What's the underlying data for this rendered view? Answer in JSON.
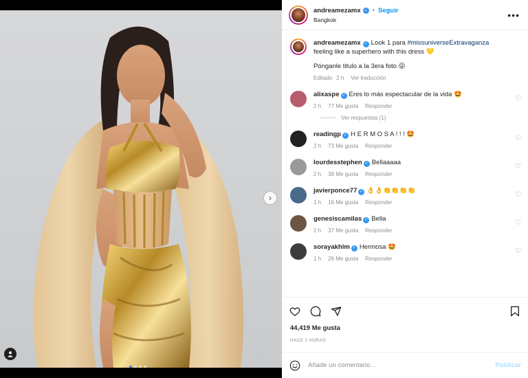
{
  "post": {
    "username": "andreamezamx",
    "follow_label": "Seguir",
    "separator": "•",
    "location": "Bangkok",
    "more_label": "•••",
    "next_label": "›"
  },
  "caption": {
    "username": "andreamezamx",
    "text_before": "Look 1 para ",
    "hashtag": "#missuniverseExtravaganza",
    "text_after": " feeling like a superhero with this dress 💛",
    "line2": "Pónganle titulo a la 3era foto 😜",
    "edited": "Editado",
    "time": "2 h",
    "translation": "Ver traducción"
  },
  "comments": [
    {
      "username": "alixaspe",
      "text": "Eres lo más espectacular de la vida 🤩",
      "time": "2 h",
      "likes": "77 Me gusta",
      "reply": "Responder",
      "avatar_color": "#b85c6e"
    },
    {
      "username": "readingp",
      "text": "H E R M O S A ! ! ! 🤩",
      "time": "2 h",
      "likes": "73 Me gusta",
      "reply": "Responder",
      "avatar_color": "#222222"
    },
    {
      "username": "lourdesstephen",
      "text": "Bellaaaaa",
      "time": "2 h",
      "likes": "38 Me gusta",
      "reply": "Responder",
      "avatar_color": "#9a9a9a"
    },
    {
      "username": "javierponce77",
      "text": "👌👌👏👏👏👏",
      "time": "1 h",
      "likes": "16 Me gusta",
      "reply": "Responder",
      "avatar_color": "#4a6a8a"
    },
    {
      "username": "genesiscamilas",
      "text": "Bella",
      "time": "2 h",
      "likes": "37 Me gusta",
      "reply": "Responder",
      "avatar_color": "#6b5544"
    },
    {
      "username": "sorayakhlm",
      "text": "Hermosa 🤩",
      "time": "1 h",
      "likes": "26 Me gusta",
      "reply": "Responder",
      "avatar_color": "#3d3d3d"
    }
  ],
  "replies_label": "Ver respuestas (1)",
  "likes_total": "44,419 Me gusta",
  "posted_ago": "HACE 2 HORAS",
  "composer": {
    "placeholder": "Añade un comentario...",
    "post_label": "Publicar"
  },
  "carousel": {
    "count": 4,
    "active": 0
  },
  "colors": {
    "accent": "#0095f6",
    "verified": "#3897f0",
    "hashtag": "#00376b",
    "dress_gold": "#c9a03c"
  },
  "icons": [
    "heart-icon",
    "comment-icon",
    "share-icon",
    "bookmark-icon",
    "emoji-icon",
    "more-icon",
    "chevron-right-icon",
    "user-tag-icon"
  ]
}
